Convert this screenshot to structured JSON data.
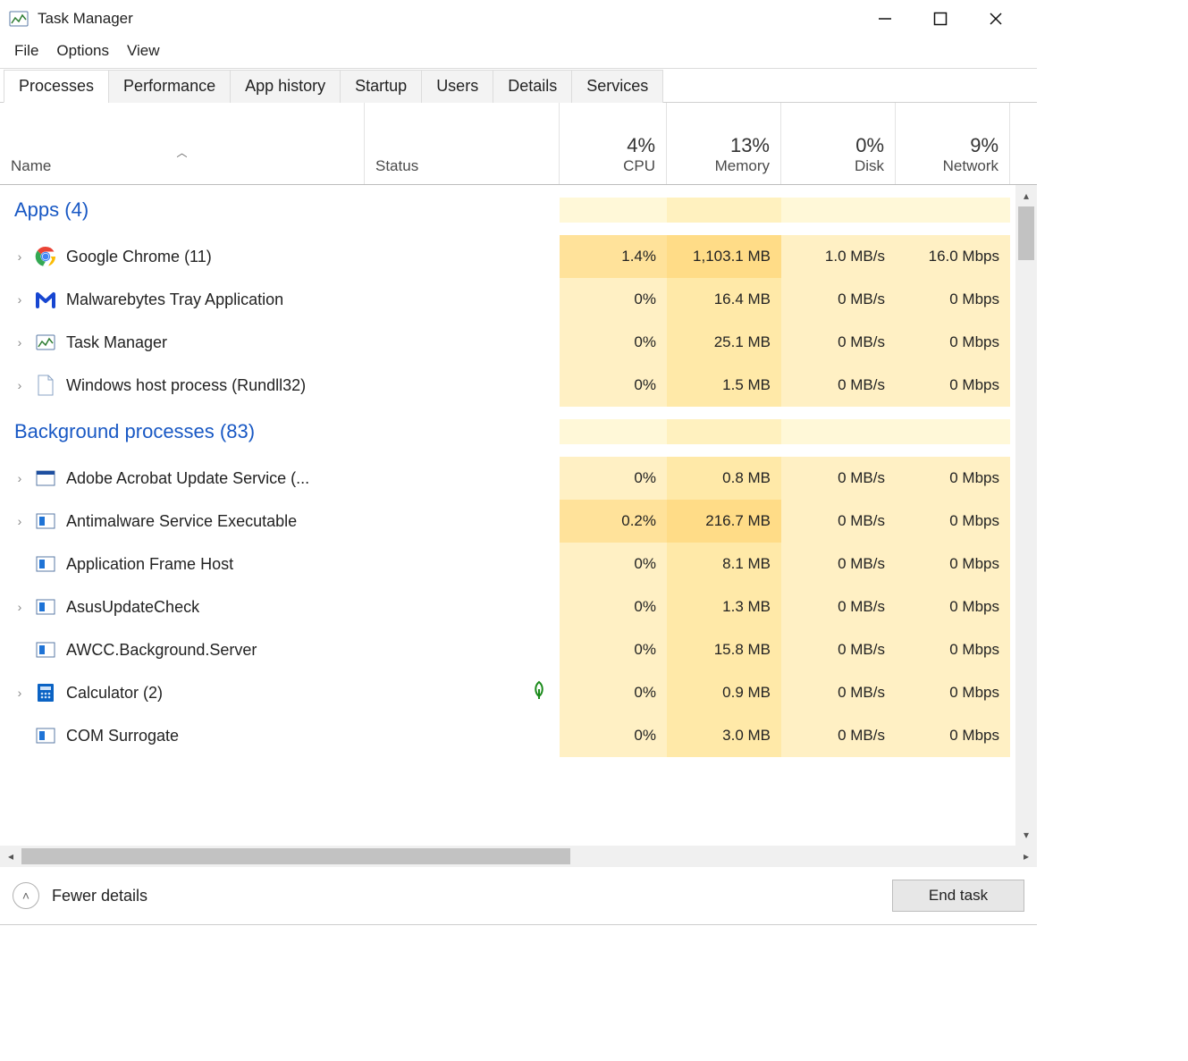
{
  "window": {
    "title": "Task Manager"
  },
  "menu": {
    "file": "File",
    "options": "Options",
    "view": "View"
  },
  "tabs": {
    "processes": "Processes",
    "performance": "Performance",
    "app_history": "App history",
    "startup": "Startup",
    "users": "Users",
    "details": "Details",
    "services": "Services"
  },
  "headers": {
    "name": "Name",
    "status": "Status",
    "cpu_pct": "4%",
    "cpu": "CPU",
    "mem_pct": "13%",
    "mem": "Memory",
    "disk_pct": "0%",
    "disk": "Disk",
    "net_pct": "9%",
    "net": "Network"
  },
  "groups": {
    "apps": "Apps (4)",
    "bg": "Background processes (83)"
  },
  "rows": [
    {
      "group": "apps",
      "icon": "chrome",
      "name": "Google Chrome (11)",
      "expand": true,
      "cpu": "1.4%",
      "mem": "1,103.1 MB",
      "disk": "1.0 MB/s",
      "net": "16.0 Mbps",
      "hot": true
    },
    {
      "group": "apps",
      "icon": "malwarebytes",
      "name": "Malwarebytes Tray Application",
      "expand": true,
      "cpu": "0%",
      "mem": "16.4 MB",
      "disk": "0 MB/s",
      "net": "0 Mbps"
    },
    {
      "group": "apps",
      "icon": "taskmgr",
      "name": "Task Manager",
      "expand": true,
      "cpu": "0%",
      "mem": "25.1 MB",
      "disk": "0 MB/s",
      "net": "0 Mbps"
    },
    {
      "group": "apps",
      "icon": "file",
      "name": "Windows host process (Rundll32)",
      "expand": true,
      "cpu": "0%",
      "mem": "1.5 MB",
      "disk": "0 MB/s",
      "net": "0 Mbps"
    },
    {
      "group": "bg",
      "icon": "generic",
      "name": "Adobe Acrobat Update Service (...",
      "expand": true,
      "cpu": "0%",
      "mem": "0.8 MB",
      "disk": "0 MB/s",
      "net": "0 Mbps"
    },
    {
      "group": "bg",
      "icon": "service",
      "name": "Antimalware Service Executable",
      "expand": true,
      "cpu": "0.2%",
      "mem": "216.7 MB",
      "disk": "0 MB/s",
      "net": "0 Mbps",
      "hot": true
    },
    {
      "group": "bg",
      "icon": "service",
      "name": "Application Frame Host",
      "expand": false,
      "cpu": "0%",
      "mem": "8.1 MB",
      "disk": "0 MB/s",
      "net": "0 Mbps"
    },
    {
      "group": "bg",
      "icon": "service",
      "name": "AsusUpdateCheck",
      "expand": true,
      "cpu": "0%",
      "mem": "1.3 MB",
      "disk": "0 MB/s",
      "net": "0 Mbps"
    },
    {
      "group": "bg",
      "icon": "service",
      "name": "AWCC.Background.Server",
      "expand": false,
      "cpu": "0%",
      "mem": "15.8 MB",
      "disk": "0 MB/s",
      "net": "0 Mbps"
    },
    {
      "group": "bg",
      "icon": "calc",
      "name": "Calculator (2)",
      "expand": true,
      "leaf": true,
      "cpu": "0%",
      "mem": "0.9 MB",
      "disk": "0 MB/s",
      "net": "0 Mbps"
    },
    {
      "group": "bg",
      "icon": "service",
      "name": "COM Surrogate",
      "expand": false,
      "cpu": "0%",
      "mem": "3.0 MB",
      "disk": "0 MB/s",
      "net": "0 Mbps"
    }
  ],
  "footer": {
    "fewer": "Fewer details",
    "end_task": "End task"
  }
}
